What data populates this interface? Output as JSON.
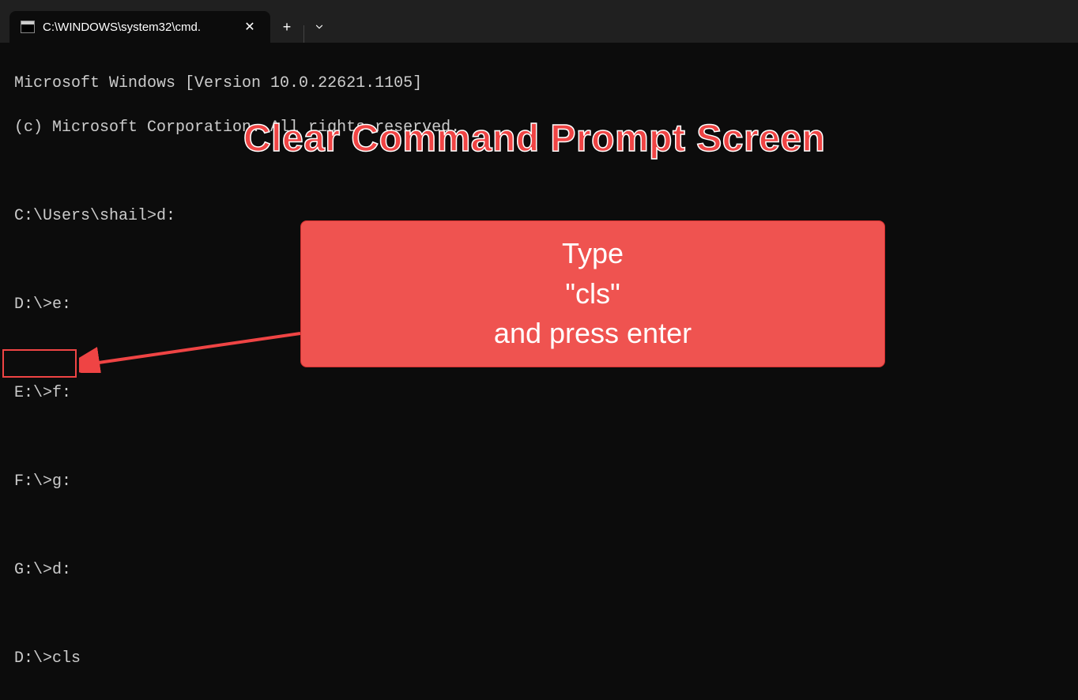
{
  "tab": {
    "title": "C:\\WINDOWS\\system32\\cmd."
  },
  "terminal": {
    "lines": [
      "Microsoft Windows [Version 10.0.22621.1105]",
      "(c) Microsoft Corporation. All rights reserved.",
      "",
      "C:\\Users\\shail>d:",
      "",
      "D:\\>e:",
      "",
      "E:\\>f:",
      "",
      "F:\\>g:",
      "",
      "G:\\>d:",
      "",
      "D:\\>cls"
    ]
  },
  "annotation": {
    "title": "Clear Command Prompt Screen",
    "box_line1": "Type",
    "box_line2": "\"cls\"",
    "box_line3": "and press enter"
  }
}
